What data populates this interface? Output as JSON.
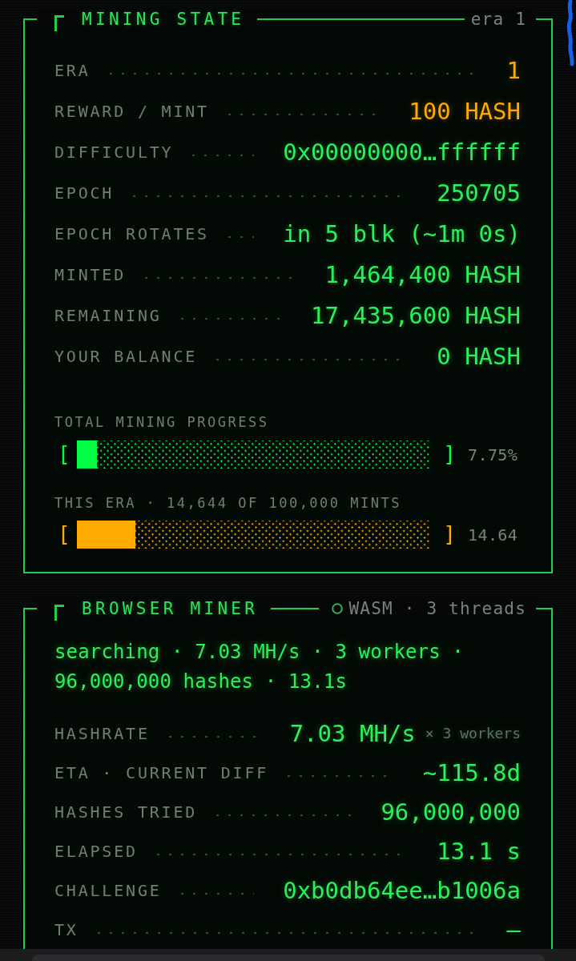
{
  "mining_state": {
    "title": "MINING STATE",
    "badge": "era 1",
    "rows": [
      {
        "label": "ERA",
        "value": "1",
        "color": "#ffaa00"
      },
      {
        "label": "REWARD / MINT",
        "value": "100 HASH",
        "color": "#ffaa00"
      },
      {
        "label": "DIFFICULTY",
        "value": "0x00000000…ffffff",
        "color": "#2af05a"
      },
      {
        "label": "EPOCH",
        "value": "250705",
        "color": "#2af05a"
      },
      {
        "label": "EPOCH ROTATES",
        "value": "in 5 blk (~1m 0s)",
        "color": "#2af05a"
      },
      {
        "label": "MINTED",
        "value": "1,464,400 HASH",
        "color": "#2af05a"
      },
      {
        "label": "REMAINING",
        "value": "17,435,600 HASH",
        "color": "#2af05a"
      },
      {
        "label": "YOUR BALANCE",
        "value": "0 HASH",
        "color": "#2af05a"
      }
    ],
    "progress": [
      {
        "label": "TOTAL MINING PROGRESS",
        "open": "[",
        "close": "]",
        "level": 0.057,
        "reading": "7.75%",
        "color": "#00ff44"
      },
      {
        "label": "THIS ERA · 14,644 OF 100,000 MINTS",
        "open": "[",
        "close": "]",
        "level": 0.166,
        "reading": "14.64",
        "color": "#ffaa00"
      }
    ]
  },
  "browser_miner": {
    "title": "BROWSER MINER",
    "badge": "WASM · 3 threads",
    "status": "searching · 7.03 MH/s · 3 workers · 96,000,000 hashes · 13.1s",
    "rows": [
      {
        "label": "HASHRATE",
        "value": "7.03 MH/s",
        "note": "× 3 workers"
      },
      {
        "label": "ETA · CURRENT DIFF",
        "value": "~115.8d"
      },
      {
        "label": "HASHES TRIED",
        "value": "96,000,000"
      },
      {
        "label": "ELAPSED",
        "value": "13.1 s"
      },
      {
        "label": "CHALLENGE",
        "value": "0xb0db64ee…b1006a"
      },
      {
        "label": "TX",
        "value": "—"
      }
    ]
  }
}
